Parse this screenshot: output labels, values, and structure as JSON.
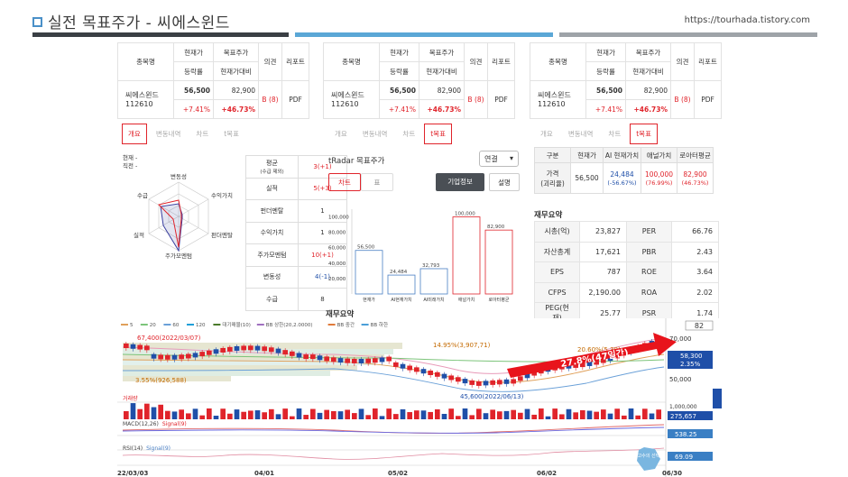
{
  "header": {
    "title": "실전 목표주가 - 씨에스윈드",
    "url": "https://tourhada.tistory.com"
  },
  "summary": {
    "headers": {
      "name": "종목명",
      "price": "현재가",
      "change": "등락률",
      "target": "목표주가",
      "vs": "현재가대비",
      "opinion": "의견",
      "report": "리포트"
    },
    "stock": {
      "name": "씨에스윈드",
      "code": "112610",
      "price": "56,500",
      "change": "+7.41%",
      "target": "82,900",
      "vs": "+46.73%",
      "opinion": "B (8)",
      "report": "PDF"
    }
  },
  "tabs": {
    "left": [
      "개요",
      "변동내역",
      "차트",
      "t목표"
    ],
    "mid": [
      "개요",
      "변동내역",
      "차트",
      "t목표"
    ],
    "right": [
      "개요",
      "변동내역",
      "차트",
      "t목표"
    ]
  },
  "radar": {
    "legend1": "현재 -",
    "legend2": "직전 -",
    "axes": [
      "변동성",
      "수익가치",
      "펀더멘탈",
      "주가모멘텀",
      "실적",
      "수급"
    ]
  },
  "stat": {
    "rows": [
      {
        "k": "평균",
        "k2": "(수급 제외)",
        "v": "3(+1)",
        "red": true
      },
      {
        "k": "실적",
        "v": "5(+3)",
        "red": true
      },
      {
        "k": "펀더멘탈",
        "v": "1",
        "red": false
      },
      {
        "k": "수익가치",
        "v": "1",
        "red": false
      },
      {
        "k": "주가모멘텀",
        "v": "10(+1)",
        "red": true
      },
      {
        "k": "변동성",
        "v": "4(-1)",
        "blue": true
      },
      {
        "k": "수급",
        "v": "8",
        "red": false
      }
    ]
  },
  "tradar": {
    "title": "tRadar 목표주가",
    "select": "연결",
    "btn_chart": "차트",
    "btn_table": "표",
    "btn_info": "기업정보",
    "btn_desc": "설명",
    "yticks": [
      "100,000",
      "80,000",
      "60,000",
      "40,000",
      "20,000"
    ],
    "bars": [
      {
        "label": "현재가",
        "value": 56500,
        "text": "56,500",
        "color": "#4a7fc4"
      },
      {
        "label": "AI현재가치",
        "value": 24484,
        "text": "24,484",
        "color": "#4a7fc4"
      },
      {
        "label": "AI미래가치",
        "value": 32793,
        "text": "32,793",
        "color": "#4a7fc4"
      },
      {
        "label": "애널가치",
        "value": 100000,
        "text": "100,000",
        "color": "#e0242b"
      },
      {
        "label": "로아터평균",
        "value": 82900,
        "text": "82,900",
        "color": "#e0242b"
      }
    ]
  },
  "valuation": {
    "headers": [
      "구분",
      "현재가",
      "AI 현재가치",
      "애널가치",
      "로아터평균"
    ],
    "label": "가격",
    "label2": "(괴리율)",
    "price": "56,500",
    "ai": "24,484",
    "ai_gap": "(-56.67%)",
    "anal": "100,000",
    "anal_gap": "(76.99%)",
    "avg": "82,900",
    "avg_gap": "(46.73%)"
  },
  "fin": {
    "title": "재무요약",
    "rows": [
      [
        "시총(억)",
        "23,827",
        "PER",
        "66.76"
      ],
      [
        "자산총계",
        "17,621",
        "PBR",
        "2.43"
      ],
      [
        "EPS",
        "787",
        "ROE",
        "3.64"
      ],
      [
        "CFPS",
        "2,190.00",
        "ROA",
        "2.02"
      ],
      [
        "PEG(현재)",
        "25.77",
        "PSR",
        "1.74"
      ]
    ]
  },
  "fin2_title": "재무요약",
  "chart": {
    "legend": [
      "5",
      "20",
      "60",
      "120",
      "대기매물(10)",
      "BB 상한(20,2.0000)",
      "BB 중간",
      "BB 하한"
    ],
    "annotations": {
      "high": "67,400(2022/03/07)",
      "low": "45,600(2022/06/13)",
      "pct1": "14.95%(3,907,71)",
      "pct2": "20.60%(5,38)",
      "pct3": "3.55%(926,588)",
      "arrow": "27.8%(47일간)",
      "vol": "거래량",
      "macd": "MACD(12,26)",
      "signal": "Signal(9)",
      "rsi": "RSI(14)",
      "rsi_signal": "Signal(9)"
    },
    "right_labels": {
      "top": "82",
      "p70": "70,000",
      "price": "58,300",
      "pct": "2.35%",
      "p50": "50,000",
      "vol1": "1,000,000",
      "vol2": "275,657",
      "macd": "538.25",
      "rsi": "69.09"
    },
    "dates": [
      "22/03/03",
      "04/01",
      "05/02",
      "06/02",
      "06/30"
    ],
    "badge": "고수의 선택"
  }
}
